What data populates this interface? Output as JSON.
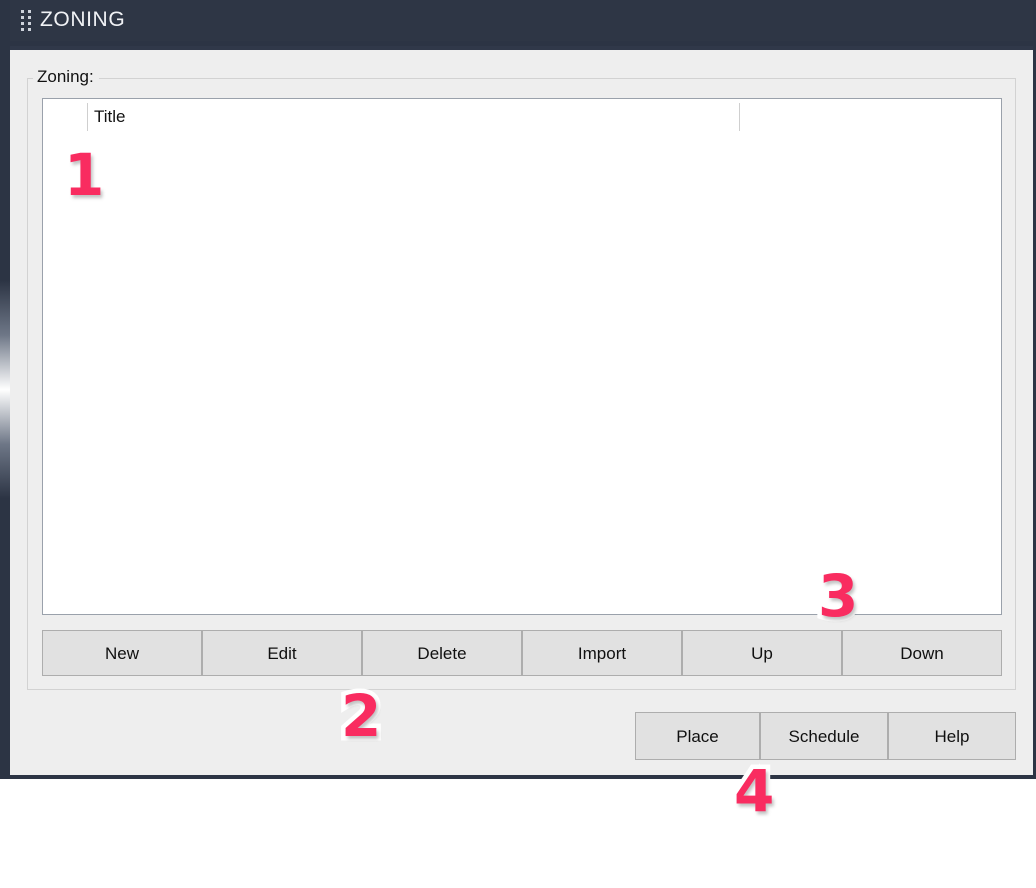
{
  "window": {
    "title": "ZONING",
    "grip_icon": "drag-grip-icon",
    "titlebar_color": "#2e3645",
    "body_color": "#eeeeee"
  },
  "group": {
    "legend": "Zoning:"
  },
  "list": {
    "columns": [
      "",
      "Title",
      ""
    ],
    "title_header": "Title",
    "rows": []
  },
  "toolbar": {
    "buttons": [
      {
        "label": "New"
      },
      {
        "label": "Edit"
      },
      {
        "label": "Delete"
      },
      {
        "label": "Import"
      },
      {
        "label": "Up"
      },
      {
        "label": "Down"
      }
    ]
  },
  "actions": {
    "buttons": [
      {
        "label": "Place"
      },
      {
        "label": "Schedule"
      },
      {
        "label": "Help"
      }
    ]
  },
  "annotations": {
    "color": "#f92c60",
    "markers": [
      {
        "number": "1"
      },
      {
        "number": "2"
      },
      {
        "number": "3"
      },
      {
        "number": "4"
      }
    ]
  }
}
